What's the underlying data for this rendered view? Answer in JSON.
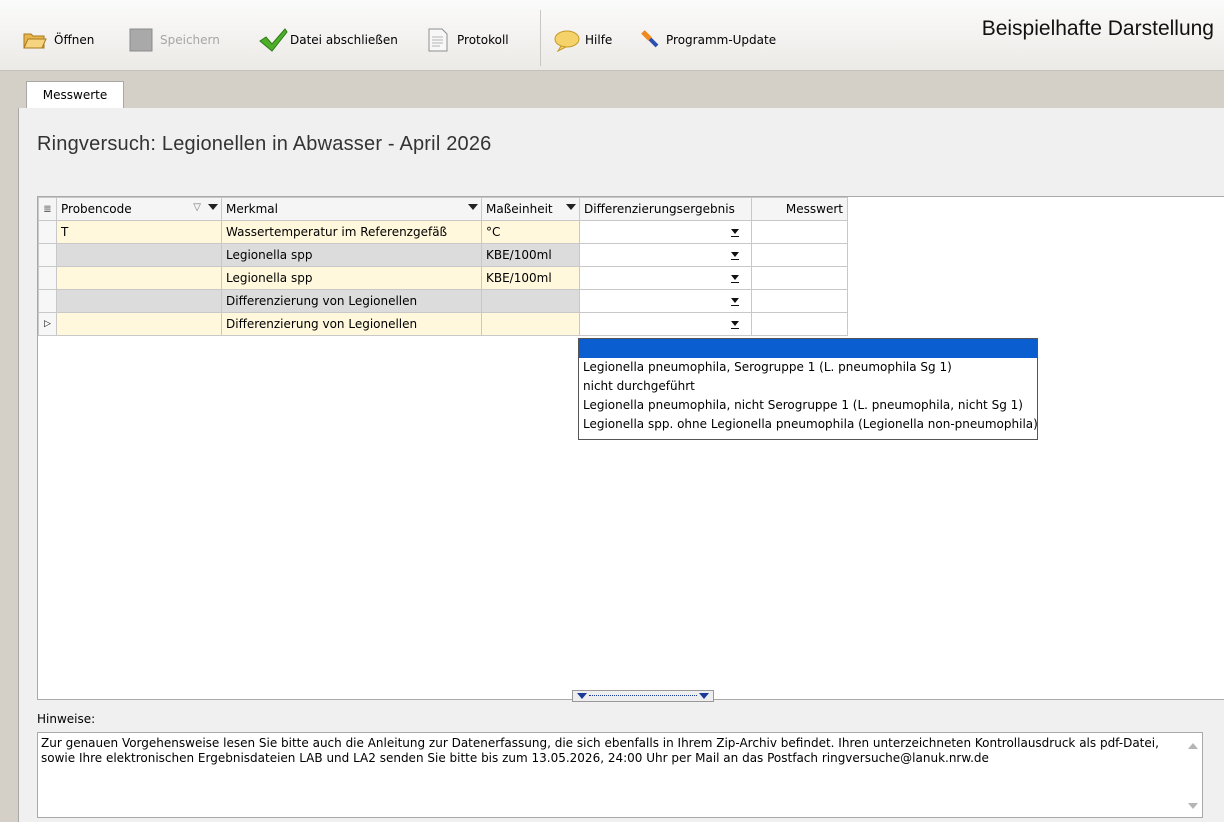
{
  "toolbar": {
    "open_label": "Öffnen",
    "save_label": "Speichern",
    "close_file_label": "Datei abschließen",
    "protocol_label": "Protokoll",
    "help_label": "Hilfe",
    "update_label": "Programm-Update",
    "heading": "Beispielhafte Darstellung"
  },
  "tabs": [
    {
      "label": "Messwerte"
    }
  ],
  "page_title": "Ringversuch: Legionellen in Abwasser - April 2026",
  "grid": {
    "columns": [
      "Probencode",
      "Merkmal",
      "Maßeinheit",
      "Differenzierungsergebnis",
      "Messwert"
    ],
    "rows": [
      {
        "probencode": "T",
        "merkmal": "Wassertemperatur im Referenzgefäß",
        "einheit": "°C",
        "ergebnis": "",
        "messwert": ""
      },
      {
        "probencode": "",
        "merkmal": "Legionella spp",
        "einheit": "KBE/100ml",
        "ergebnis": "",
        "messwert": ""
      },
      {
        "probencode": "",
        "merkmal": "Legionella spp",
        "einheit": "KBE/100ml",
        "ergebnis": "",
        "messwert": ""
      },
      {
        "probencode": "",
        "merkmal": "Differenzierung von Legionellen",
        "einheit": "",
        "ergebnis": "",
        "messwert": ""
      },
      {
        "probencode": "",
        "merkmal": "Differenzierung von Legionellen",
        "einheit": "",
        "ergebnis": "",
        "messwert": ""
      }
    ]
  },
  "dropdown_options": [
    "",
    "Legionella pneumophila, Serogruppe 1 (L. pneumophila Sg 1)",
    "nicht durchgeführt",
    "Legionella pneumophila, nicht Serogruppe 1 (L. pneumophila, nicht Sg 1)",
    "Legionella spp. ohne Legionella pneumophila (Legionella non-pneumophila)"
  ],
  "hints": {
    "label": "Hinweise:",
    "text": "Zur genauen Vorgehensweise lesen Sie bitte auch die Anleitung zur Datenerfassung, die sich ebenfalls in Ihrem Zip-Archiv befindet.  Ihren unterzeichneten Kontrollausdruck als pdf-Datei, sowie Ihre elektronischen Ergebnisdateien LAB und  LA2 senden Sie bitte bis zum 13.05.2026, 24:00 Uhr  per Mail an das Postfach ringversuche@lanuk.nrw.de"
  },
  "colors": {
    "selection": "#0a5ecf",
    "editable_cell": "#fff8dc",
    "readonly_cell": "#dcdcdc"
  }
}
